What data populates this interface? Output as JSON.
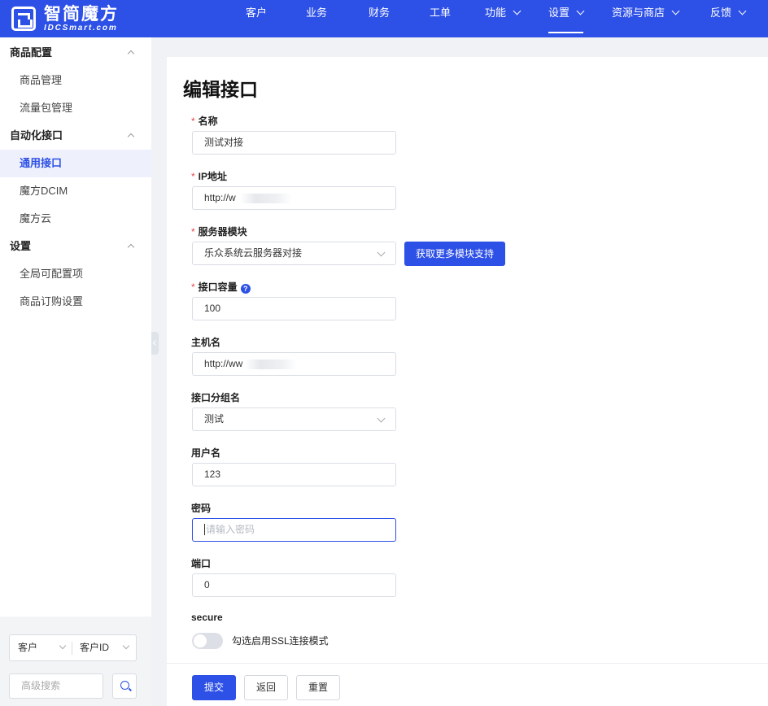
{
  "brand": {
    "name_cn": "智简魔方",
    "name_en": "IDCSmart.com"
  },
  "nav": {
    "items": [
      {
        "label": "客户",
        "dropdown": false
      },
      {
        "label": "业务",
        "dropdown": false
      },
      {
        "label": "财务",
        "dropdown": false
      },
      {
        "label": "工单",
        "dropdown": false
      },
      {
        "label": "功能",
        "dropdown": true
      },
      {
        "label": "设置",
        "dropdown": true,
        "active": true
      },
      {
        "label": "资源与商店",
        "dropdown": true
      },
      {
        "label": "反馈",
        "dropdown": true
      }
    ]
  },
  "sidebar": {
    "groups": [
      {
        "label": "商品配置",
        "items": [
          "商品管理",
          "流量包管理"
        ]
      },
      {
        "label": "自动化接口",
        "items": [
          "通用接口",
          "魔方DCIM",
          "魔方云"
        ]
      },
      {
        "label": "设置",
        "items": [
          "全局可配置项",
          "商品订购设置"
        ]
      }
    ],
    "active_item": "通用接口",
    "search": {
      "type_left": "客户",
      "type_right": "客户ID",
      "placeholder": "高级搜索"
    }
  },
  "form": {
    "title": "编辑接口",
    "fields": {
      "name": {
        "label": "名称",
        "required": true,
        "value": "测试对接"
      },
      "ip": {
        "label": "IP地址",
        "required": true,
        "value": "http://w"
      },
      "module": {
        "label": "服务器模块",
        "required": true,
        "value": "乐众系统云服务器对接",
        "action": "获取更多模块支持"
      },
      "capacity": {
        "label": "接口容量",
        "required": true,
        "value": "100",
        "help_icon": "question-icon"
      },
      "hostname": {
        "label": "主机名",
        "required": false,
        "value": "http://ww"
      },
      "group": {
        "label": "接口分组名",
        "required": false,
        "value": "测试"
      },
      "username": {
        "label": "用户名",
        "required": false,
        "value": "123"
      },
      "password": {
        "label": "密码",
        "required": false,
        "value": "",
        "placeholder": "请输入密码"
      },
      "port": {
        "label": "端口",
        "required": false,
        "value": "0"
      },
      "secure": {
        "label": "secure",
        "toggle_label": "勾选启用SSL连接模式",
        "enabled": false
      }
    },
    "buttons": {
      "submit": "提交",
      "back": "返回",
      "reset": "重置"
    }
  },
  "colors": {
    "primary": "#2d50e6",
    "required": "#e5484d",
    "bg": "#f0f2f5"
  }
}
